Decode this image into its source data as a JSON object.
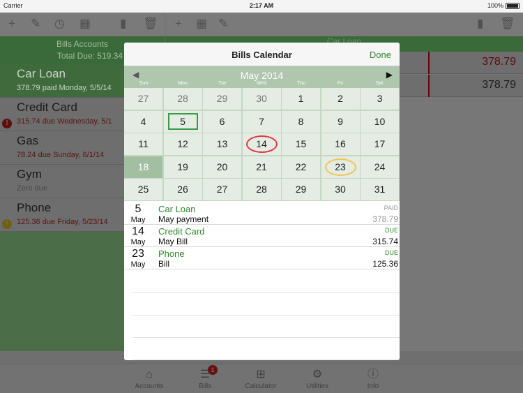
{
  "status": {
    "carrier": "Carrier",
    "time": "2:17 AM",
    "battery": "100%"
  },
  "left": {
    "title": "Bills Accounts",
    "total": "Total Due: 519.34",
    "accounts": [
      {
        "name": "Car Loan",
        "sub": "378.79 paid Monday, 5/5/14"
      },
      {
        "name": "Credit Card",
        "sub": "315.74 due Wednesday, 5/1"
      },
      {
        "name": "Gas",
        "sub": "78.24 due Sunday, 6/1/14"
      },
      {
        "name": "Gym",
        "sub": "Zero due"
      },
      {
        "name": "Phone",
        "sub": "125.36 due Friday, 5/23/14"
      }
    ]
  },
  "right": {
    "title": "Car Loan",
    "rows": [
      "378.79",
      "378.79"
    ]
  },
  "icons": {
    "add": "+",
    "edit": "✎",
    "history": "◷",
    "calendar": "▦",
    "chart": "▮",
    "trash": "🗑",
    "alert": "!"
  },
  "modal": {
    "title": "Bills Calendar",
    "done": "Done",
    "month": "May 2014",
    "prev": "◀",
    "next": "▶",
    "dows": [
      "Sun",
      "Mon",
      "Tue",
      "Wed",
      "Thu",
      "Fri",
      "Sat"
    ],
    "weeks": [
      [
        "27",
        "28",
        "29",
        "30",
        "1",
        "2",
        "3"
      ],
      [
        "4",
        "5",
        "6",
        "7",
        "8",
        "9",
        "10"
      ],
      [
        "11",
        "12",
        "13",
        "14",
        "15",
        "16",
        "17"
      ],
      [
        "18",
        "19",
        "20",
        "21",
        "22",
        "23",
        "24"
      ],
      [
        "25",
        "26",
        "27",
        "28",
        "29",
        "30",
        "31"
      ]
    ],
    "bills": [
      {
        "day": "5",
        "month": "May",
        "account": "Car Loan",
        "desc": "May payment",
        "status": "PAID",
        "amount": "378.79"
      },
      {
        "day": "14",
        "month": "May",
        "account": "Credit Card",
        "desc": "May Bill",
        "status": "DUE",
        "amount": "315.74"
      },
      {
        "day": "23",
        "month": "May",
        "account": "Phone",
        "desc": "Bill",
        "status": "DUE",
        "amount": "125.36"
      }
    ]
  },
  "tabs": [
    {
      "label": "Accounts",
      "icon": "camera-icon"
    },
    {
      "label": "Bills",
      "icon": "bills-icon",
      "badge": "1"
    },
    {
      "label": "Calculator",
      "icon": "calculator-icon"
    },
    {
      "label": "Utilities",
      "icon": "gear-icon"
    },
    {
      "label": "Info",
      "icon": "info-icon"
    }
  ],
  "colors": {
    "accent": "#2e8b2e",
    "calendar_header": "#aec7ad",
    "due_red": "#e0373f",
    "due_yellow": "#f0c650"
  }
}
